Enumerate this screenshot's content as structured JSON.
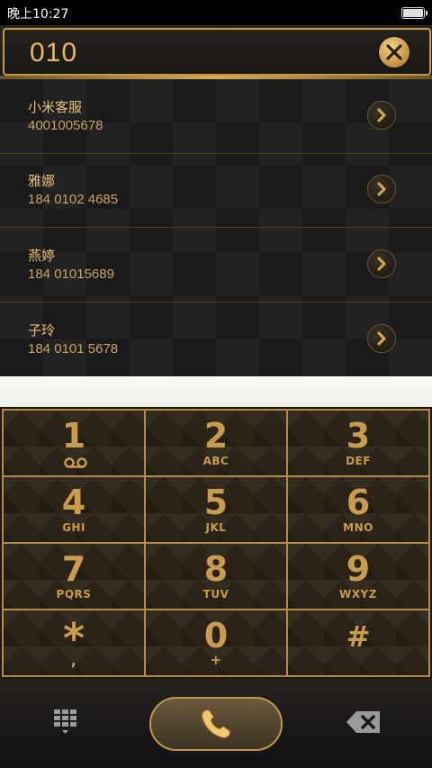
{
  "status": {
    "time": "晚上10:27"
  },
  "dial": {
    "number": "010"
  },
  "results": [
    {
      "name": "小米客服",
      "phone": "4001005678"
    },
    {
      "name": "雅娜",
      "phone": "184 0102 4685"
    },
    {
      "name": "燕婷",
      "phone": "184 01015689"
    },
    {
      "name": "子玲",
      "phone": "184 0101 5678"
    }
  ],
  "keys": [
    {
      "digit": "1",
      "sub": ""
    },
    {
      "digit": "2",
      "sub": "ABC"
    },
    {
      "digit": "3",
      "sub": "DEF"
    },
    {
      "digit": "4",
      "sub": "GHI"
    },
    {
      "digit": "5",
      "sub": "JKL"
    },
    {
      "digit": "6",
      "sub": "MNO"
    },
    {
      "digit": "7",
      "sub": "PQRS"
    },
    {
      "digit": "8",
      "sub": "TUV"
    },
    {
      "digit": "9",
      "sub": "WXYZ"
    },
    {
      "digit": "*",
      "sub": ","
    },
    {
      "digit": "0",
      "sub": "+"
    },
    {
      "digit": "#",
      "sub": ""
    }
  ],
  "icons": {
    "clear": "clear-x-icon",
    "result_go": "chevron-right-icon",
    "voicemail": "voicemail-icon",
    "keypad": "keypad-icon",
    "call": "phone-icon",
    "backspace": "backspace-icon"
  },
  "colors": {
    "accent_gold": "#c99b4c",
    "text_gold": "#e6c07a",
    "background_dark": "#1a1a1a"
  }
}
